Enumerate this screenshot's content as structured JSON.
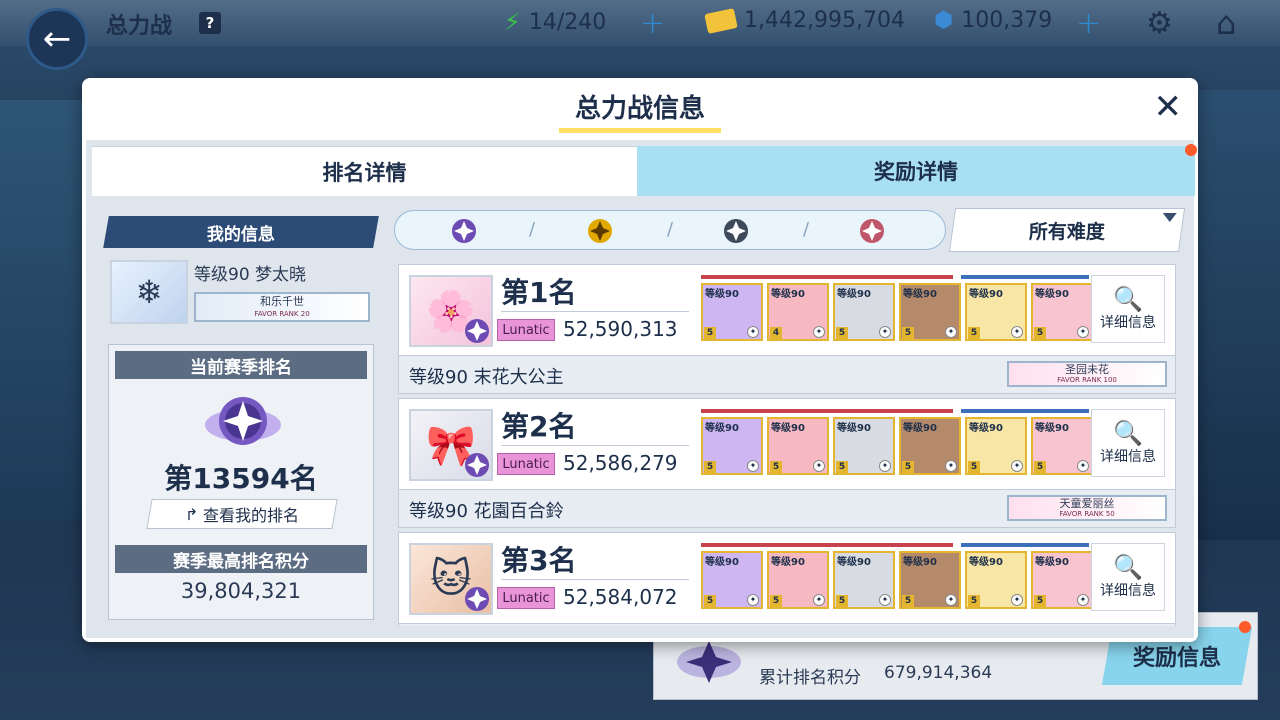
{
  "header": {
    "title": "总力战",
    "help_icon": "question-icon",
    "stamina": "14/240",
    "credits": "1,442,995,704",
    "gems": "100,379"
  },
  "background_card": {
    "total_label": "累计排名积分",
    "total_value": "679,914,364",
    "reward_button": "奖励信息"
  },
  "modal": {
    "title": "总力战信息",
    "tabs": [
      {
        "label": "排名详情",
        "active": true
      },
      {
        "label": "奖励详情",
        "active": false
      }
    ],
    "my_info": {
      "header": "我的信息",
      "level_name": "等级90 梦太晓",
      "favor_name": "和乐千世",
      "favor_rank": "FAVOR RANK 20",
      "current_rank_label": "当前赛季排名",
      "current_rank_value": "第13594名",
      "view_rank_button": "查看我的排名",
      "best_score_label": "赛季最高排名积分",
      "best_score_value": "39,804,321"
    },
    "filter": {
      "tiers": [
        "platinum",
        "gold",
        "silver",
        "bronze"
      ],
      "tier_colors": [
        "#6d4bb3",
        "#e0a800",
        "#3e4a5a",
        "#c0566a"
      ],
      "difficulty": "所有难度"
    },
    "entries": [
      {
        "rank": "第1名",
        "difficulty": "Lunatic",
        "score": "52,590,313",
        "level_name": "等级90 末花大公主",
        "favor_name": "圣园未花",
        "favor_rank": "FAVOR RANK 100",
        "detail_label": "详细信息",
        "team": [
          "等级90",
          "等级90",
          "等级90",
          "等级90",
          "等级90",
          "等级90"
        ],
        "stars": [
          "5",
          "4",
          "5",
          "5",
          "5",
          "5"
        ]
      },
      {
        "rank": "第2名",
        "difficulty": "Lunatic",
        "score": "52,586,279",
        "level_name": "等级90 花園百合鈴",
        "favor_name": "天童爱丽丝",
        "favor_rank": "FAVOR RANK 50",
        "detail_label": "详细信息",
        "team": [
          "等级90",
          "等级90",
          "等级90",
          "等级90",
          "等级90",
          "等级90"
        ],
        "stars": [
          "5",
          "5",
          "5",
          "5",
          "5",
          "5"
        ]
      },
      {
        "rank": "第3名",
        "difficulty": "Lunatic",
        "score": "52,584,072",
        "level_name": "",
        "favor_name": "",
        "favor_rank": "",
        "detail_label": "详细信息",
        "team": [
          "等级90",
          "等级90",
          "等级90",
          "等级90",
          "等级90",
          "等级90"
        ],
        "stars": [
          "5",
          "5",
          "5",
          "5",
          "5",
          "5"
        ]
      }
    ]
  }
}
